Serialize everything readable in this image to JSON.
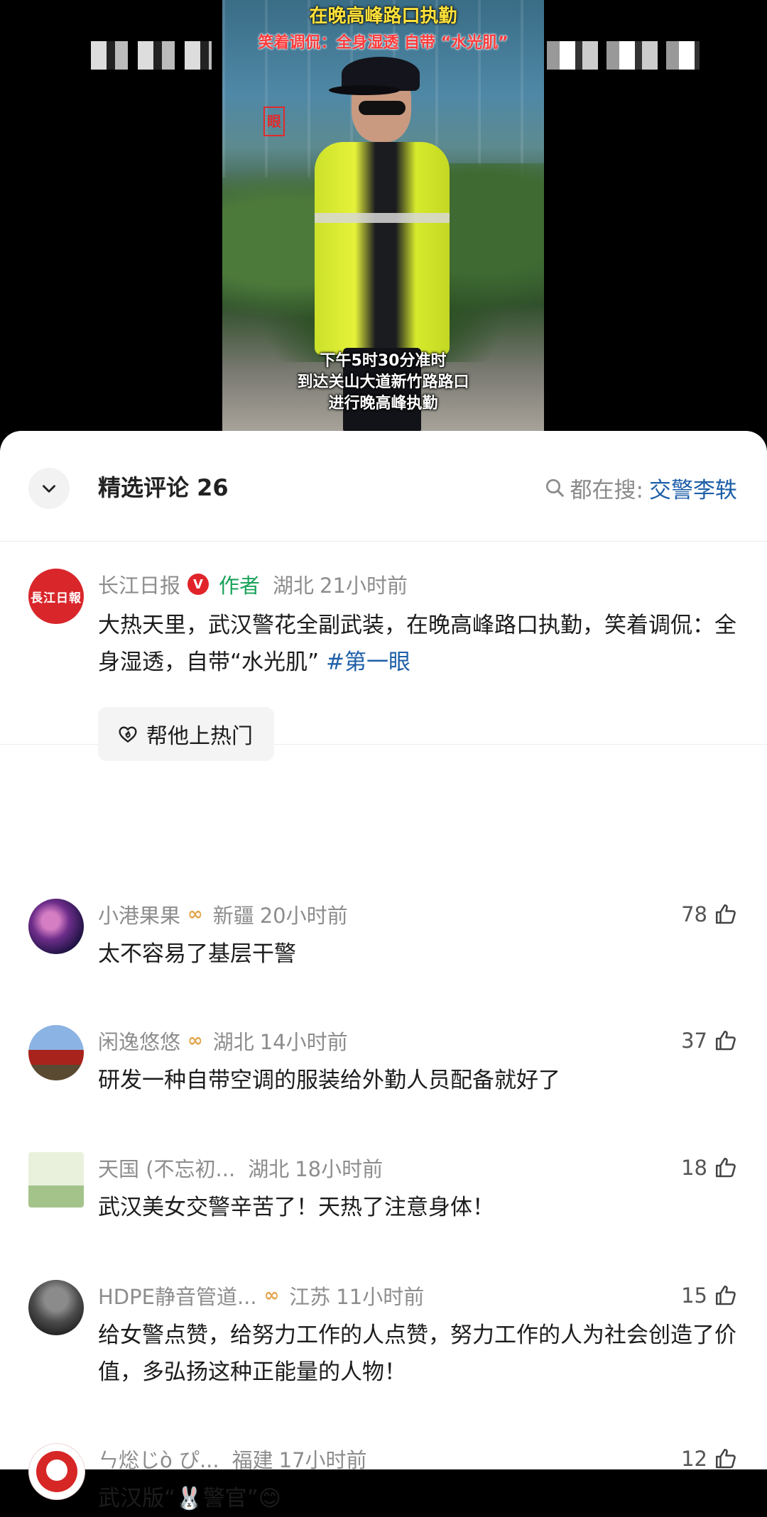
{
  "video": {
    "title": "在晚高峰路口执勤",
    "subtitle": "笑着调侃：全身湿透 自带 “水光肌”",
    "caption_lines": [
      "下午5时30分准时",
      "到达关山大道新竹路路口",
      "进行晚高峰执勤"
    ],
    "corner_tag": "眼"
  },
  "comments_panel": {
    "title": "精选评论 26",
    "search_prefix": "都在搜:",
    "search_term": "交警李轶"
  },
  "author_comment": {
    "avatar_text": "長江日報",
    "name": "长江日报",
    "verified_badge": "V",
    "author_tag": "作者",
    "location": "湖北",
    "time": "21小时前",
    "text_main": "大热天里，武汉警花全副武装，在晚高峰路口执勤，笑着调侃：全身湿透，自带“水光肌” ",
    "hashtag": "#第一眼",
    "hot_button_label": "帮他上热门"
  },
  "comments": [
    {
      "name": "小港果果",
      "vip": true,
      "location": "新疆",
      "time": "20小时前",
      "likes": "78",
      "text": "太不容易了基层干警"
    },
    {
      "name": "闲逸悠悠",
      "vip": true,
      "location": "湖北",
      "time": "14小时前",
      "likes": "37",
      "text": "研发一种自带空调的服装给外勤人员配备就好了"
    },
    {
      "name": "天国 (不忘初...",
      "vip": false,
      "location": "湖北",
      "time": "18小时前",
      "likes": "18",
      "text": "武汉美女交警辛苦了！天热了注意身体！"
    },
    {
      "name": "HDPE静音管道...",
      "vip": true,
      "location": "江苏",
      "time": "11小时前",
      "likes": "15",
      "text": "给女警点赞，给努力工作的人点赞，努力工作的人为社会创造了价值，多弘扬这种正能量的人物！"
    },
    {
      "name": "ㄣ焧じò ぴ...",
      "vip": false,
      "location": "福建",
      "time": "17小时前",
      "likes": "12",
      "text": "武汉版“🐰警官”😊"
    }
  ],
  "icons": {
    "collapse": "chevron-down-icon",
    "search": "search-icon",
    "hot": "heart-flame-icon",
    "like": "thumbs-up-icon",
    "vip": "vip-badge-icon"
  },
  "colors": {
    "link_blue": "#1e5fa8",
    "author_green": "#1aa25a",
    "verified_red": "#e0242a",
    "vip_gold": "#e2a54c"
  }
}
